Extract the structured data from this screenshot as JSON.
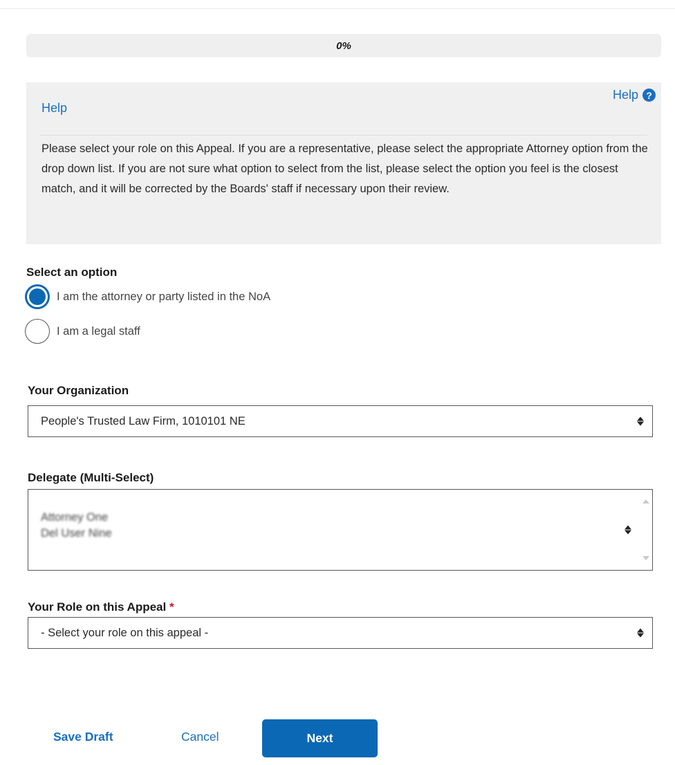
{
  "progress": {
    "text": "0%",
    "value": 0
  },
  "help": {
    "toggle_label": "Help",
    "toggle_icon": "question-circle-icon",
    "heading": "Help",
    "text": "Please select your role on this Appeal. If you are a representative, please select the appropriate Attorney option from the drop down list. If you are not sure what option to select from the list, please select the option you feel is the closest match, and it will be corrected by the Boards' staff if necessary upon their review."
  },
  "option_group": {
    "label": "Select an option",
    "options": [
      {
        "label": "I am the attorney or party listed in the NoA",
        "checked": true
      },
      {
        "label": "I am a legal staff",
        "checked": false
      }
    ]
  },
  "organization": {
    "label": "Your Organization",
    "value": "People's Trusted Law Firm, 1010101 NE"
  },
  "delegate": {
    "label": "Delegate (Multi-Select)",
    "items": [
      "Attorney One",
      "Del User Nine"
    ]
  },
  "role": {
    "label": "Your Role on this Appeal",
    "required_mark": "*",
    "value": "- Select your role on this appeal -"
  },
  "actions": {
    "save_draft": "Save Draft",
    "cancel": "Cancel",
    "next": "Next"
  },
  "colors": {
    "accent": "#0b68b4",
    "link": "#1a6fc1",
    "required": "#d3102b",
    "help_bg": "#f0f0f0"
  }
}
